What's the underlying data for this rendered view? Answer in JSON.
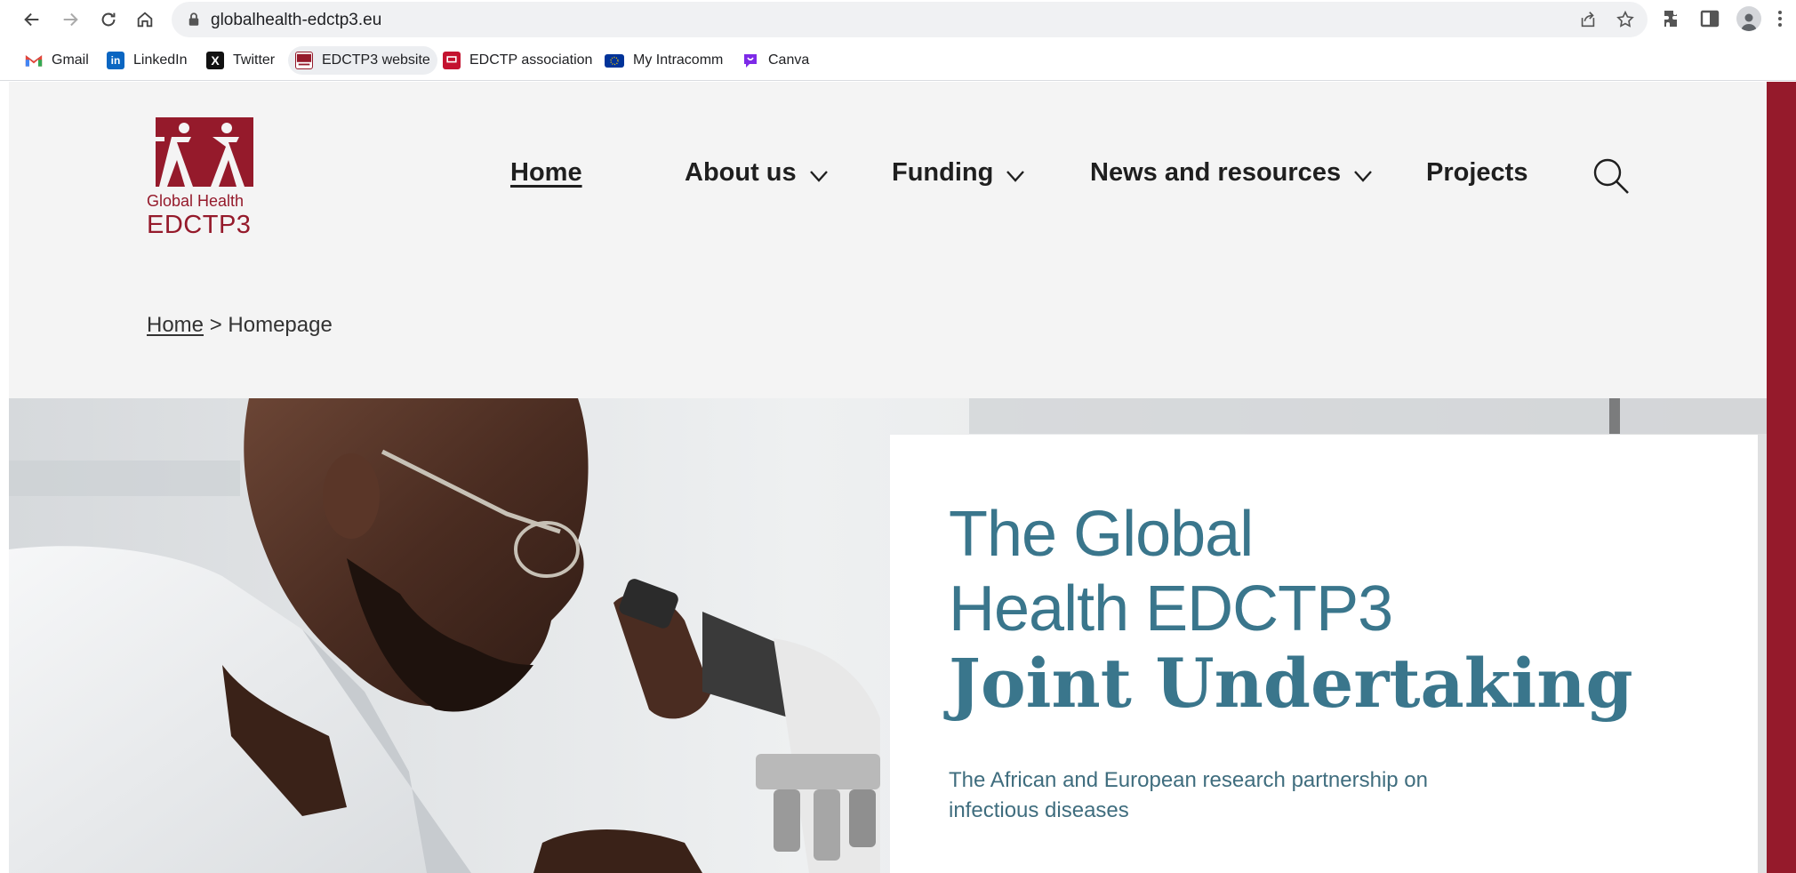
{
  "browser": {
    "url": "globalhealth-edctp3.eu",
    "bookmarks": [
      {
        "label": "Gmail",
        "icon": "gmail-icon"
      },
      {
        "label": "LinkedIn",
        "icon": "linkedin-icon"
      },
      {
        "label": "Twitter",
        "icon": "x-twitter-icon"
      },
      {
        "label": "EDCTP3 website",
        "icon": "edctp3-favicon"
      },
      {
        "label": "EDCTP association",
        "icon": "edctp-favicon"
      },
      {
        "label": "My Intracomm",
        "icon": "eu-flag-icon"
      },
      {
        "label": "Canva",
        "icon": "canva-icon"
      }
    ]
  },
  "site": {
    "logo_line1": "Global Health",
    "logo_line2": "EDCTP3",
    "brand_color": "#951a2b",
    "accent_color": "#3a768c"
  },
  "nav": {
    "home": "Home",
    "about": "About us",
    "funding": "Funding",
    "news": "News and resources",
    "projects": "Projects"
  },
  "breadcrumb": {
    "home": "Home",
    "separator": " > ",
    "current": "Homepage"
  },
  "hero": {
    "title_line1": "The Global",
    "title_line2": "Health EDCTP3",
    "title_line3": "Joint Undertaking",
    "subtitle": "The African and European research partnership on infectious diseases"
  }
}
